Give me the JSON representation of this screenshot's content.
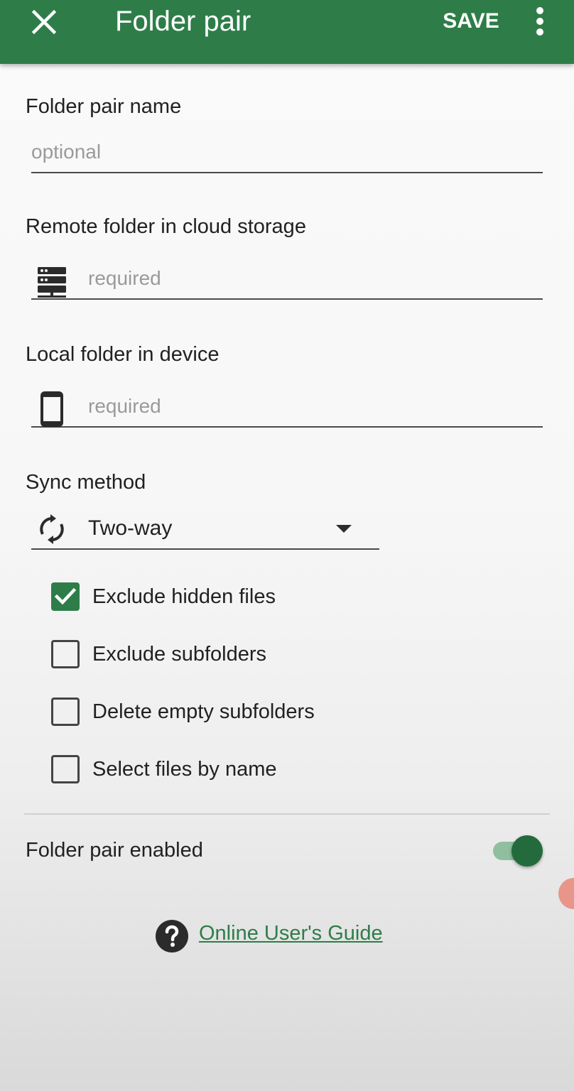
{
  "appbar": {
    "title": "Folder pair",
    "save_label": "SAVE",
    "close_icon": "close-icon",
    "menu_icon": "more-vert-icon",
    "background_color": "#2e7d49"
  },
  "form": {
    "name": {
      "label": "Folder pair name",
      "placeholder": "optional"
    },
    "remote": {
      "label": "Remote folder in cloud storage",
      "placeholder": "required",
      "icon": "server-icon"
    },
    "local": {
      "label": "Local folder in device",
      "placeholder": "required",
      "icon": "phone-icon"
    },
    "sync": {
      "label": "Sync method",
      "value": "Two-way",
      "icon": "sync-icon"
    },
    "options": [
      {
        "label": "Exclude hidden files",
        "checked": true
      },
      {
        "label": "Exclude subfolders",
        "checked": false
      },
      {
        "label": "Delete empty subfolders",
        "checked": false
      },
      {
        "label": "Select files by name",
        "checked": false
      }
    ],
    "enabled": {
      "label": "Folder pair enabled",
      "on": true
    }
  },
  "help": {
    "link_text": "Online User's Guide",
    "icon": "help-icon"
  },
  "accent_color": "#2e7d49"
}
